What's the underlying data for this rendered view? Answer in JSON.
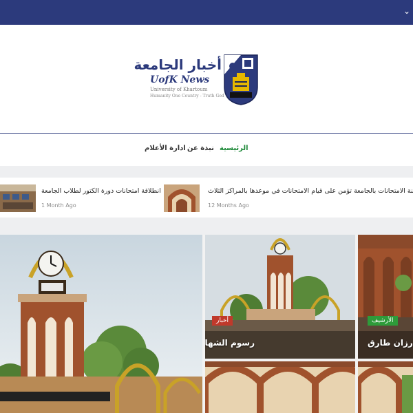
{
  "colors": {
    "brand": "#2c3a7c",
    "active_nav": "#1f8a3a",
    "badge_news": "#c0392b",
    "badge_archive": "#2e9b3a"
  },
  "topbar": {
    "chevron_icon": "chevron-down-icon"
  },
  "logo": {
    "arabic": "أخبار الجامعة",
    "english": "UofK News",
    "subtitle": "University of Khartoum",
    "motto": "Humanity One Country - Truth  God"
  },
  "nav": {
    "items": [
      {
        "label": "الرئيسية",
        "active": true
      },
      {
        "label": "نبذة عن",
        "active": false
      },
      {
        "label": "ادارة الأعلام",
        "active": false
      }
    ]
  },
  "ticker": {
    "items": [
      {
        "title": "لجنة الامتحانات بالجامعة تؤمن على قيام الامتحانات في موعدها بالمراكز الثلاث",
        "time": "12 Months Ago"
      },
      {
        "title": "انطلاقة امتحانات دورة الكتور لطلاب الجامعة",
        "time": "1 Month Ago"
      }
    ]
  },
  "cards": [
    {
      "badge": "أخبار",
      "title": "رسوم الشهادات"
    },
    {
      "badge": "الأرشيف",
      "title": "طالبة رزان طارق"
    }
  ]
}
